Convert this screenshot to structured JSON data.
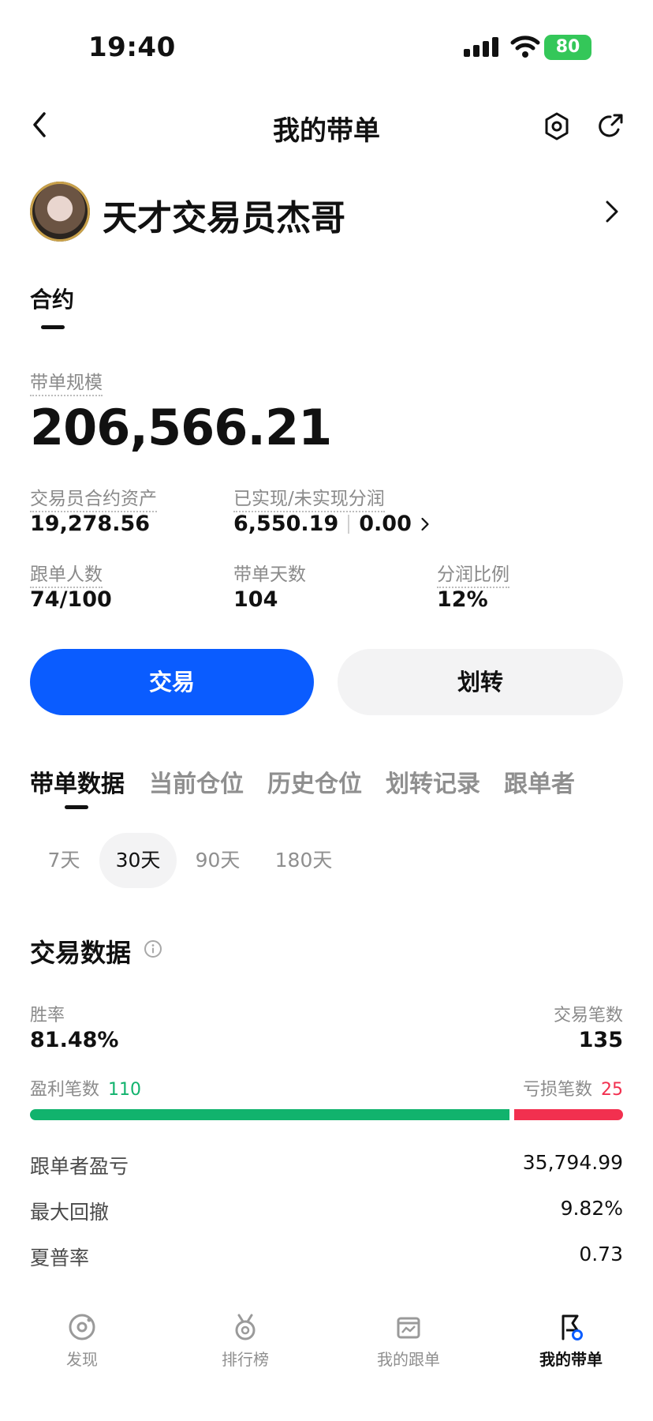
{
  "status_bar": {
    "time": "19:40",
    "battery": "80"
  },
  "nav": {
    "title": "我的带单"
  },
  "profile": {
    "name": "天才交易员杰哥"
  },
  "section_tab": {
    "label": "合约"
  },
  "summary": {
    "scale_label": "带单规模",
    "scale_value": "206,566.21",
    "assets_label": "交易员合约资产",
    "assets_value": "19,278.56",
    "profit_label": "已实现/未实现分润",
    "profit_realized": "6,550.19",
    "profit_unrealized": "0.00",
    "followers_label": "跟单人数",
    "followers_value": "74/100",
    "days_label": "带单天数",
    "days_value": "104",
    "share_label": "分润比例",
    "share_value": "12%"
  },
  "actions": {
    "trade": "交易",
    "transfer": "划转"
  },
  "tabs": [
    "带单数据",
    "当前仓位",
    "历史仓位",
    "划转记录",
    "跟单者"
  ],
  "periods": [
    "7天",
    "30天",
    "90天",
    "180天"
  ],
  "trade_data": {
    "title": "交易数据",
    "win_rate_label": "胜率",
    "win_rate_value": "81.48%",
    "trades_label": "交易笔数",
    "trades_value": "135",
    "profit_trades_label": "盈利笔数",
    "profit_trades_value": "110",
    "loss_trades_label": "亏损笔数",
    "loss_trades_value": "25",
    "profit_ratio": 0.815,
    "rows": [
      {
        "label": "跟单者盈亏",
        "value": "35,794.99"
      },
      {
        "label": "最大回撤",
        "value": "9.82%"
      },
      {
        "label": "夏普率",
        "value": "0.73"
      }
    ]
  },
  "bottom_nav": [
    {
      "label": "发现",
      "icon": "discover-icon"
    },
    {
      "label": "排行榜",
      "icon": "medal-icon"
    },
    {
      "label": "我的跟单",
      "icon": "chart-board-icon"
    },
    {
      "label": "我的带单",
      "icon": "flag-icon"
    }
  ],
  "colors": {
    "accent": "#0a5cff",
    "green": "#11b36d",
    "red": "#f2304f"
  }
}
